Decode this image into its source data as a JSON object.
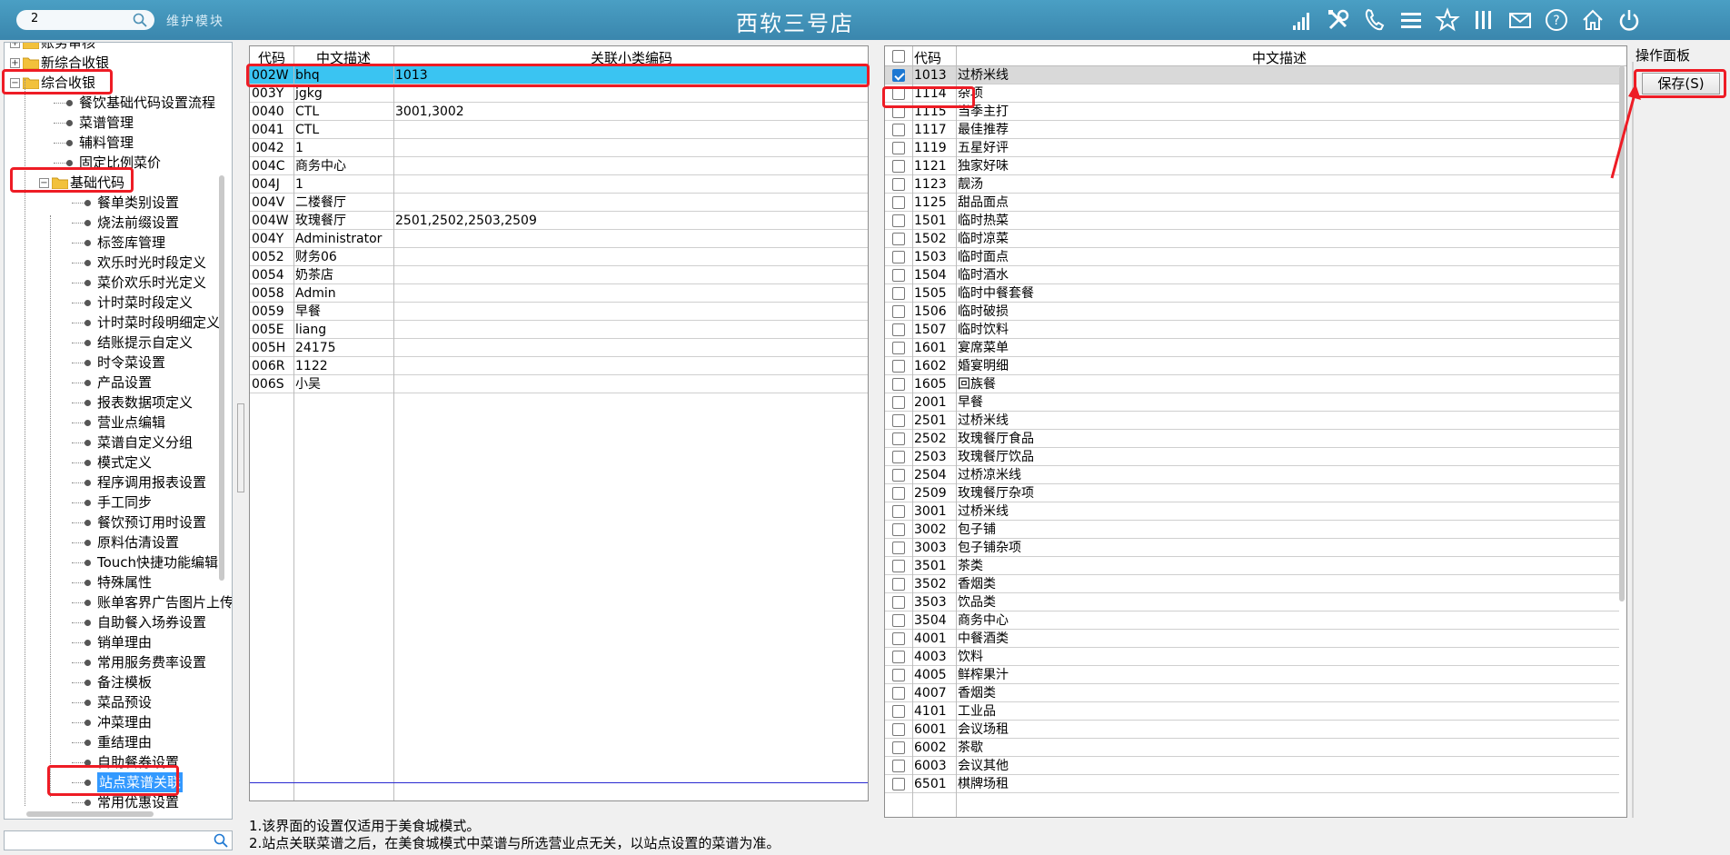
{
  "header": {
    "search_value": "2",
    "module_label": "维护模块",
    "title": "西软三号店",
    "icons": [
      "signal-icon",
      "tools-icon",
      "phone-icon",
      "menu-icon",
      "star-icon",
      "columns-icon",
      "mail-icon",
      "help-icon",
      "home-icon",
      "power-icon"
    ]
  },
  "tree": {
    "items": [
      {
        "label": "账务审核",
        "level": 0,
        "type": "folder"
      },
      {
        "label": "新综合收银",
        "level": 0,
        "type": "folder"
      },
      {
        "label": "综合收银",
        "level": 0,
        "type": "folder-open"
      },
      {
        "label": "餐饮基础代码设置流程",
        "level": 1,
        "type": "leaf"
      },
      {
        "label": "菜谱管理",
        "level": 1,
        "type": "leaf"
      },
      {
        "label": "辅料管理",
        "level": 1,
        "type": "leaf"
      },
      {
        "label": "固定比例菜价",
        "level": 1,
        "type": "leaf"
      },
      {
        "label": "基础代码",
        "level": 1,
        "type": "folder-open"
      },
      {
        "label": "餐单类别设置",
        "level": 2,
        "type": "leaf"
      },
      {
        "label": "烧法前缀设置",
        "level": 2,
        "type": "leaf"
      },
      {
        "label": "标签库管理",
        "level": 2,
        "type": "leaf"
      },
      {
        "label": "欢乐时光时段定义",
        "level": 2,
        "type": "leaf"
      },
      {
        "label": "菜价欢乐时光定义",
        "level": 2,
        "type": "leaf"
      },
      {
        "label": "计时菜时段定义",
        "level": 2,
        "type": "leaf"
      },
      {
        "label": "计时菜时段明细定义",
        "level": 2,
        "type": "leaf"
      },
      {
        "label": "结账提示自定义",
        "level": 2,
        "type": "leaf"
      },
      {
        "label": "时令菜设置",
        "level": 2,
        "type": "leaf"
      },
      {
        "label": "产品设置",
        "level": 2,
        "type": "leaf"
      },
      {
        "label": "报表数据项定义",
        "level": 2,
        "type": "leaf"
      },
      {
        "label": "营业点编辑",
        "level": 2,
        "type": "leaf"
      },
      {
        "label": "菜谱自定义分组",
        "level": 2,
        "type": "leaf"
      },
      {
        "label": "模式定义",
        "level": 2,
        "type": "leaf"
      },
      {
        "label": "程序调用报表设置",
        "level": 2,
        "type": "leaf"
      },
      {
        "label": "手工同步",
        "level": 2,
        "type": "leaf"
      },
      {
        "label": "餐饮预订用时设置",
        "level": 2,
        "type": "leaf"
      },
      {
        "label": "原料估清设置",
        "level": 2,
        "type": "leaf"
      },
      {
        "label": "Touch快捷功能编辑",
        "level": 2,
        "type": "leaf"
      },
      {
        "label": "特殊属性",
        "level": 2,
        "type": "leaf"
      },
      {
        "label": "账单客界广告图片上传",
        "level": 2,
        "type": "leaf"
      },
      {
        "label": "自助餐入场券设置",
        "level": 2,
        "type": "leaf"
      },
      {
        "label": "销单理由",
        "level": 2,
        "type": "leaf"
      },
      {
        "label": "常用服务费率设置",
        "level": 2,
        "type": "leaf"
      },
      {
        "label": "备注模板",
        "level": 2,
        "type": "leaf"
      },
      {
        "label": "菜品预设",
        "level": 2,
        "type": "leaf"
      },
      {
        "label": "冲菜理由",
        "level": 2,
        "type": "leaf"
      },
      {
        "label": "重结理由",
        "level": 2,
        "type": "leaf"
      },
      {
        "label": "自助餐券设置",
        "level": 2,
        "type": "leaf"
      },
      {
        "label": "站点菜谱关联",
        "level": 2,
        "type": "leaf",
        "selected": true
      },
      {
        "label": "常用优惠设置",
        "level": 2,
        "type": "leaf"
      }
    ]
  },
  "mid_grid": {
    "headers": [
      "代码",
      "中文描述",
      "关联小类编码"
    ],
    "rows": [
      {
        "code": "002W",
        "desc": "bhq",
        "link": "1013",
        "selected": true
      },
      {
        "code": "003Y",
        "desc": "jgkg",
        "link": ""
      },
      {
        "code": "0040",
        "desc": "CTL",
        "link": "3001,3002"
      },
      {
        "code": "0041",
        "desc": "CTL",
        "link": ""
      },
      {
        "code": "0042",
        "desc": "1",
        "link": ""
      },
      {
        "code": "004C",
        "desc": "商务中心",
        "link": ""
      },
      {
        "code": "004J",
        "desc": "1",
        "link": ""
      },
      {
        "code": "004V",
        "desc": "二楼餐厅",
        "link": ""
      },
      {
        "code": "004W",
        "desc": "玫瑰餐厅",
        "link": "2501,2502,2503,2509"
      },
      {
        "code": "004Y",
        "desc": "Administrator",
        "link": ""
      },
      {
        "code": "0052",
        "desc": "财务06",
        "link": ""
      },
      {
        "code": "0054",
        "desc": "奶茶店",
        "link": ""
      },
      {
        "code": "0058",
        "desc": "Admin",
        "link": ""
      },
      {
        "code": "0059",
        "desc": "早餐",
        "link": ""
      },
      {
        "code": "005E",
        "desc": "liang",
        "link": ""
      },
      {
        "code": "005H",
        "desc": "24175",
        "link": ""
      },
      {
        "code": "006R",
        "desc": "1122",
        "link": ""
      },
      {
        "code": "006S",
        "desc": "小吴",
        "link": ""
      }
    ]
  },
  "right_grid": {
    "headers": [
      "代码",
      "中文描述"
    ],
    "rows": [
      {
        "code": "1013",
        "desc": "过桥米线",
        "checked": true
      },
      {
        "code": "1114",
        "desc": "杂项",
        "checked": false
      },
      {
        "code": "1115",
        "desc": "当季主打",
        "checked": false
      },
      {
        "code": "1117",
        "desc": "最佳推荐",
        "checked": false
      },
      {
        "code": "1119",
        "desc": "五星好评",
        "checked": false
      },
      {
        "code": "1121",
        "desc": "独家好味",
        "checked": false
      },
      {
        "code": "1123",
        "desc": "靓汤",
        "checked": false
      },
      {
        "code": "1125",
        "desc": "甜品面点",
        "checked": false
      },
      {
        "code": "1501",
        "desc": "临时热菜",
        "checked": false
      },
      {
        "code": "1502",
        "desc": "临时凉菜",
        "checked": false
      },
      {
        "code": "1503",
        "desc": "临时面点",
        "checked": false
      },
      {
        "code": "1504",
        "desc": "临时酒水",
        "checked": false
      },
      {
        "code": "1505",
        "desc": "临时中餐套餐",
        "checked": false
      },
      {
        "code": "1506",
        "desc": "临时破损",
        "checked": false
      },
      {
        "code": "1507",
        "desc": "临时饮料",
        "checked": false
      },
      {
        "code": "1601",
        "desc": "宴席菜单",
        "checked": false
      },
      {
        "code": "1602",
        "desc": "婚宴明细",
        "checked": false
      },
      {
        "code": "1605",
        "desc": "回族餐",
        "checked": false
      },
      {
        "code": "2001",
        "desc": "早餐",
        "checked": false
      },
      {
        "code": "2501",
        "desc": "过桥米线",
        "checked": false
      },
      {
        "code": "2502",
        "desc": "玫瑰餐厅食品",
        "checked": false
      },
      {
        "code": "2503",
        "desc": "玫瑰餐厅饮品",
        "checked": false
      },
      {
        "code": "2504",
        "desc": "过桥凉米线",
        "checked": false
      },
      {
        "code": "2509",
        "desc": "玫瑰餐厅杂项",
        "checked": false
      },
      {
        "code": "3001",
        "desc": "过桥米线",
        "checked": false
      },
      {
        "code": "3002",
        "desc": "包子铺",
        "checked": false
      },
      {
        "code": "3003",
        "desc": "包子铺杂项",
        "checked": false
      },
      {
        "code": "3501",
        "desc": "茶类",
        "checked": false
      },
      {
        "code": "3502",
        "desc": "香烟类",
        "checked": false
      },
      {
        "code": "3503",
        "desc": "饮品类",
        "checked": false
      },
      {
        "code": "3504",
        "desc": "商务中心",
        "checked": false
      },
      {
        "code": "4001",
        "desc": "中餐酒类",
        "checked": false
      },
      {
        "code": "4003",
        "desc": "饮料",
        "checked": false
      },
      {
        "code": "4005",
        "desc": "鲜榨果汁",
        "checked": false
      },
      {
        "code": "4007",
        "desc": "香烟类",
        "checked": false
      },
      {
        "code": "4101",
        "desc": "工业品",
        "checked": false
      },
      {
        "code": "6001",
        "desc": "会议场租",
        "checked": false
      },
      {
        "code": "6002",
        "desc": "茶歇",
        "checked": false
      },
      {
        "code": "6003",
        "desc": "会议其他",
        "checked": false
      },
      {
        "code": "6501",
        "desc": "棋牌场租",
        "checked": false
      }
    ]
  },
  "ops": {
    "title": "操作面板",
    "save_label": "保存(S)"
  },
  "notes": [
    "1.该界面的设置仅适用于美食城模式。",
    "2.站点关联菜谱之后，在美食城模式中菜谱与所选营业点无关，以站点设置的菜谱为准。"
  ],
  "colors": {
    "topbar": "#4a9fc4",
    "selection_row": "#3ac4f2",
    "tree_selected": "#3399ff",
    "annotation_red": "#ee1c25",
    "checkbox_checked": "#1e78d2"
  }
}
